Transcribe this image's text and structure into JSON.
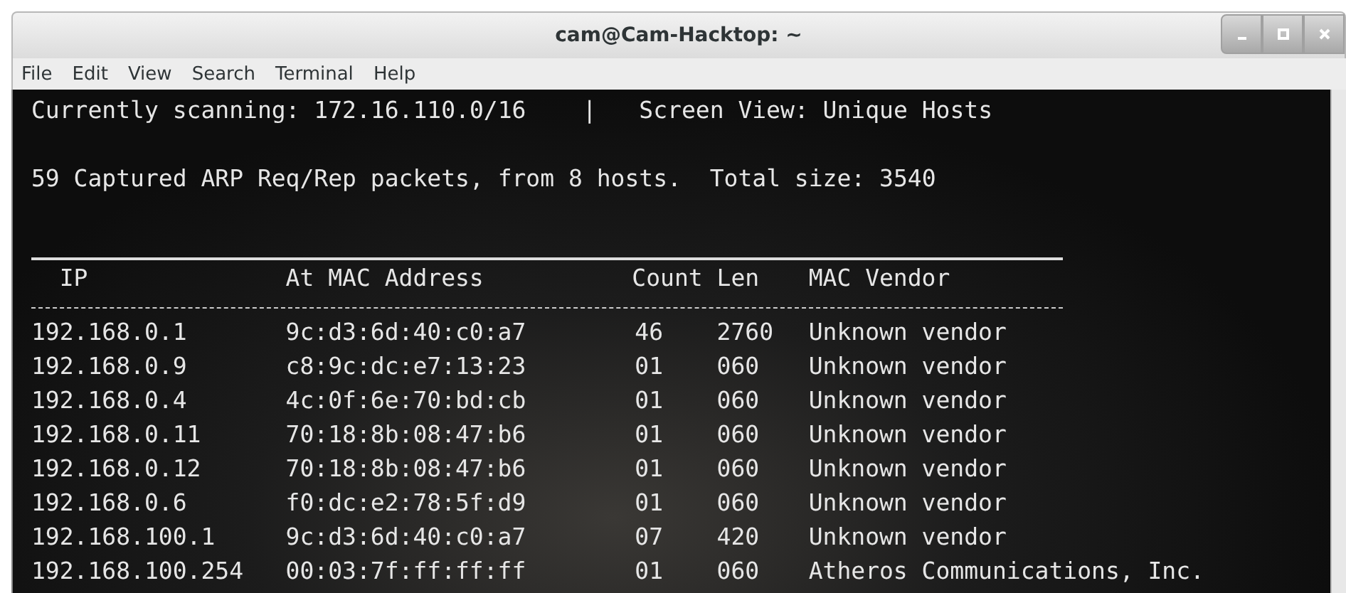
{
  "window": {
    "title": "cam@Cam-Hacktop: ~"
  },
  "menu": [
    "File",
    "Edit",
    "View",
    "Search",
    "Terminal",
    "Help"
  ],
  "terminal": {
    "status": {
      "scanning": "Currently scanning: 172.16.110.0/16",
      "separator": "|",
      "view": "Screen View: Unique Hosts"
    },
    "summary": {
      "packets": "59 Captured ARP Req/Rep packets, from 8 hosts.",
      "size": "Total size: 3540"
    },
    "columns": [
      "IP",
      "At MAC Address",
      "Count",
      "Len",
      "MAC Vendor"
    ],
    "rows": [
      {
        "ip": "192.168.0.1",
        "mac": "9c:d3:6d:40:c0:a7",
        "count": "46",
        "len": "2760",
        "vendor": "Unknown vendor"
      },
      {
        "ip": "192.168.0.9",
        "mac": "c8:9c:dc:e7:13:23",
        "count": "01",
        "len": "060",
        "vendor": "Unknown vendor"
      },
      {
        "ip": "192.168.0.4",
        "mac": "4c:0f:6e:70:bd:cb",
        "count": "01",
        "len": "060",
        "vendor": "Unknown vendor"
      },
      {
        "ip": "192.168.0.11",
        "mac": "70:18:8b:08:47:b6",
        "count": "01",
        "len": "060",
        "vendor": "Unknown vendor"
      },
      {
        "ip": "192.168.0.12",
        "mac": "70:18:8b:08:47:b6",
        "count": "01",
        "len": "060",
        "vendor": "Unknown vendor"
      },
      {
        "ip": "192.168.0.6",
        "mac": "f0:dc:e2:78:5f:d9",
        "count": "01",
        "len": "060",
        "vendor": "Unknown vendor"
      },
      {
        "ip": "192.168.100.1",
        "mac": "9c:d3:6d:40:c0:a7",
        "count": "07",
        "len": "420",
        "vendor": "Unknown vendor"
      },
      {
        "ip": "192.168.100.254",
        "mac": "00:03:7f:ff:ff:ff",
        "count": "01",
        "len": "060",
        "vendor": "Atheros Communications, Inc."
      }
    ]
  }
}
